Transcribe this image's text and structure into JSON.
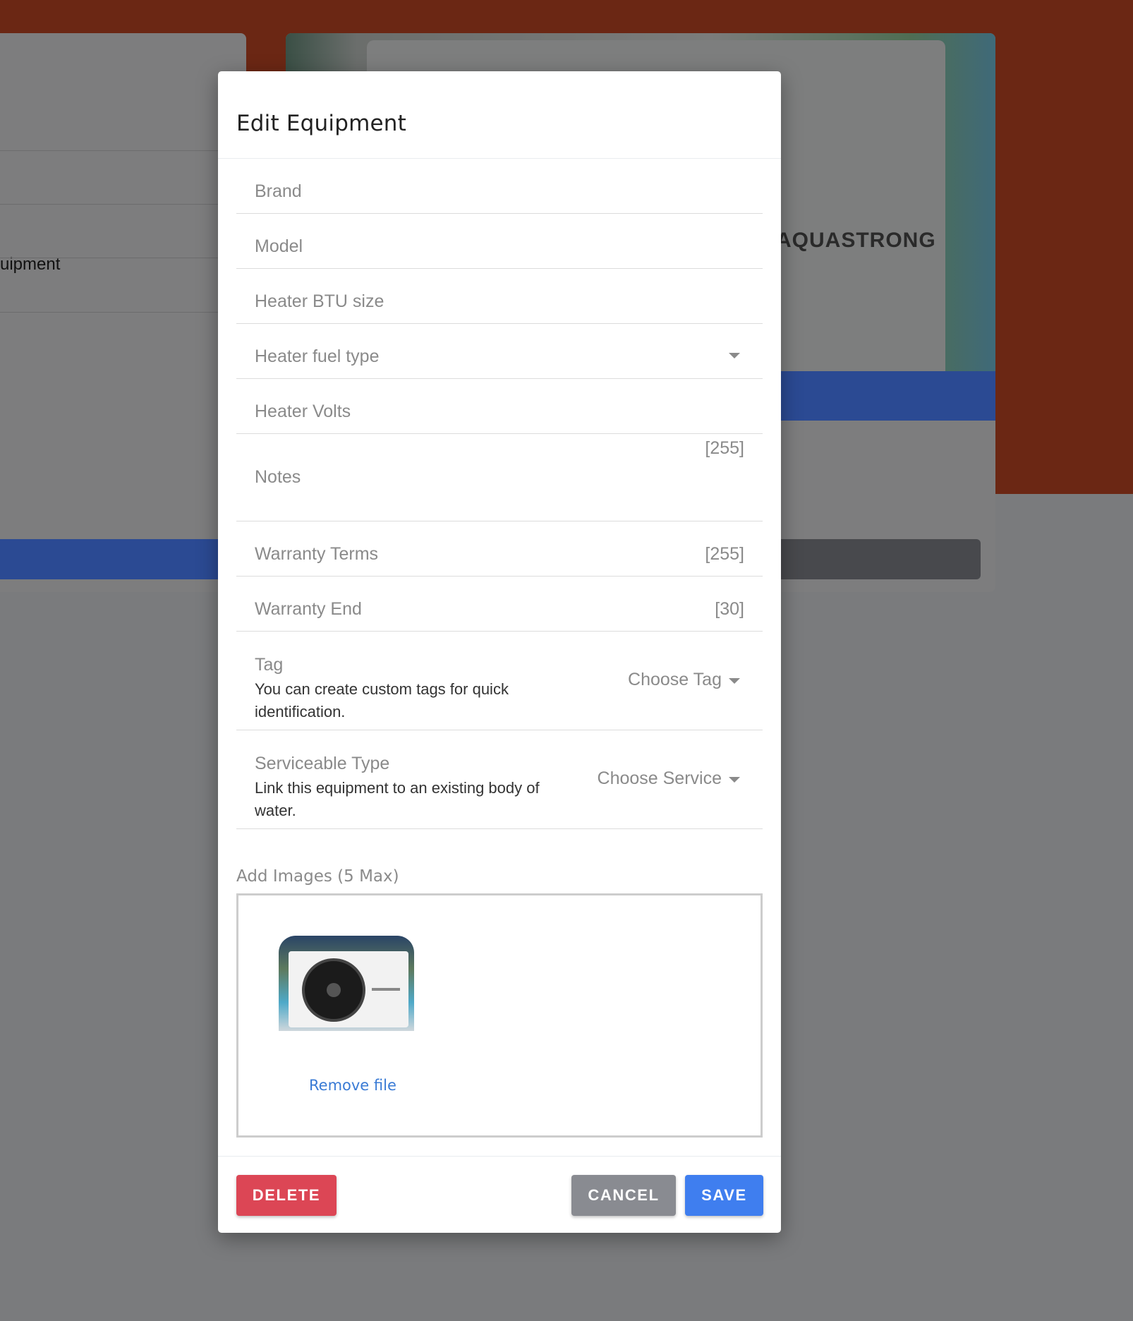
{
  "background": {
    "left_card_text": "uipment",
    "brand_text": "AQUASTRONG"
  },
  "modal": {
    "title": "Edit Equipment",
    "fields": {
      "brand": {
        "placeholder": "Brand"
      },
      "model": {
        "placeholder": "Model"
      },
      "heater_btu": {
        "placeholder": "Heater BTU size"
      },
      "heater_fuel": {
        "placeholder": "Heater fuel type"
      },
      "heater_volts": {
        "placeholder": "Heater Volts"
      },
      "notes": {
        "placeholder": "Notes",
        "counter": "[255]"
      },
      "warranty_terms": {
        "placeholder": "Warranty Terms",
        "counter": "[255]"
      },
      "warranty_end": {
        "placeholder": "Warranty End",
        "counter": "[30]"
      },
      "tag": {
        "label": "Tag",
        "help": "You can create custom tags for quick identification.",
        "select_placeholder": "Choose Tag"
      },
      "serviceable_type": {
        "label": "Serviceable Type",
        "help": "Link this equipment to an existing body of water.",
        "select_placeholder": "Choose Service"
      }
    },
    "images": {
      "label": "Add Images (5 Max)",
      "remove_label": "Remove file"
    },
    "footer": {
      "delete_label": "DELETE",
      "cancel_label": "CANCEL",
      "save_label": "SAVE"
    }
  },
  "colors": {
    "header_bg": "#6b2714",
    "overlay": "#7a7b7d",
    "delete": "#dc4655",
    "cancel": "#898b91",
    "save": "#3f7eef",
    "link": "#3a7bd5"
  }
}
